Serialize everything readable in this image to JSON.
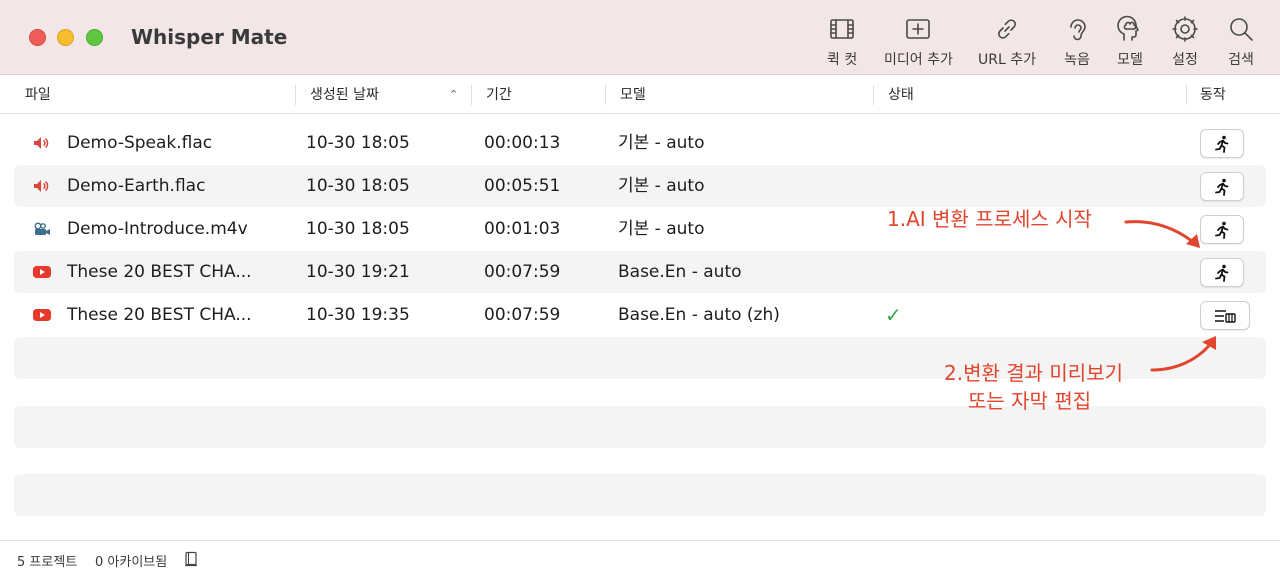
{
  "app": {
    "title": "Whisper Mate"
  },
  "toolbar": [
    {
      "label": "퀵 컷",
      "icon": "film-icon"
    },
    {
      "label": "미디어 추가",
      "icon": "add-media-icon"
    },
    {
      "label": "URL 추가",
      "icon": "link-icon"
    },
    {
      "label": "녹음",
      "icon": "ear-icon"
    },
    {
      "label": "모델",
      "icon": "brain-icon"
    },
    {
      "label": "설정",
      "icon": "gear-icon"
    },
    {
      "label": "검색",
      "icon": "search-icon"
    }
  ],
  "columns": [
    "파일",
    "생성된 날짜",
    "기간",
    "모델",
    "상태",
    "동작"
  ],
  "rows": [
    {
      "file": "Demo-Speak.flac",
      "type": "audio",
      "date": "10-30 18:05",
      "duration": "00:00:13",
      "model": "기본 - auto",
      "status": "",
      "action": "run"
    },
    {
      "file": "Demo-Earth.flac",
      "type": "audio",
      "date": "10-30 18:05",
      "duration": "00:05:51",
      "model": "기본 - auto",
      "status": "",
      "action": "run"
    },
    {
      "file": "Demo-Introduce.m4v",
      "type": "video",
      "date": "10-30 18:05",
      "duration": "00:01:03",
      "model": "기본 - auto",
      "status": "",
      "action": "run"
    },
    {
      "file": "These 20 BEST CHA...",
      "type": "youtube",
      "date": "10-30 19:21",
      "duration": "00:07:59",
      "model": "Base.En - auto",
      "status": "",
      "action": "run"
    },
    {
      "file": "These 20 BEST CHA...",
      "type": "youtube",
      "date": "10-30 19:35",
      "duration": "00:07:59",
      "model": "Base.En - auto (zh)",
      "status": "✓",
      "action": "subtitles"
    }
  ],
  "annotations": {
    "start": "1.AI 변환 프로세스 시작",
    "preview_line1": "2.변환 결과 미리보기",
    "preview_line2": "또는 자막 편집"
  },
  "statusbar": {
    "projects": "5 프로젝트",
    "archived": "0 아카이브됨"
  },
  "colors": {
    "annotation": "#e0452d",
    "youtube": "#e6392b",
    "audio": "#d9463c",
    "check": "#3aa54a"
  }
}
